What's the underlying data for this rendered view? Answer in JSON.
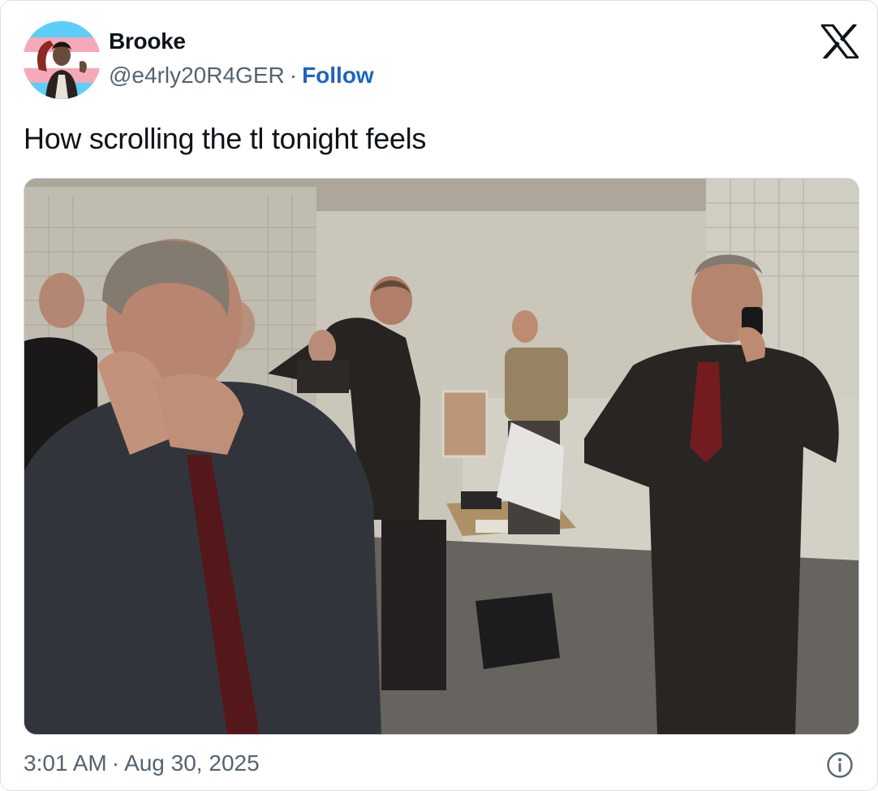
{
  "tweet": {
    "author": {
      "display_name": "Brooke",
      "handle": "@e4rly20R4GER",
      "separator": "·",
      "follow_label": "Follow",
      "avatar_icon": "trans-flag-profile-avatar"
    },
    "platform_icon": "x-logo-icon",
    "text": "How scrolling the tl tonight feels",
    "media": {
      "type": "photo",
      "alt": ""
    },
    "timestamp": {
      "time": "3:01 AM",
      "separator": "·",
      "date": "Aug 30, 2025"
    },
    "info_icon": "info-icon"
  },
  "colors": {
    "follow_link": "#1d65c2",
    "secondary_text": "#536471",
    "primary_text": "#0f1419",
    "border": "#d9dee2"
  }
}
